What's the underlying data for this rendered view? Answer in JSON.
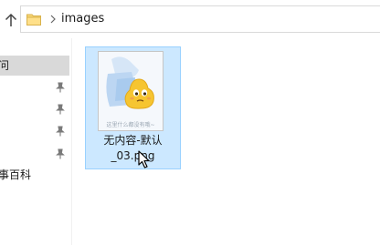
{
  "address_bar": {
    "path_segment": "images",
    "up_icon": "arrow-up-icon",
    "folder_icon": "folder-icon",
    "separator_icon": "chevron-right-icon"
  },
  "nav_pane": {
    "items": [
      {
        "label": "问",
        "selected": true,
        "pinned": false
      },
      {
        "label": "",
        "selected": false,
        "pinned": true
      },
      {
        "label": "",
        "selected": false,
        "pinned": true
      },
      {
        "label": "",
        "selected": false,
        "pinned": true
      },
      {
        "label": "",
        "selected": false,
        "pinned": true
      },
      {
        "label": "事百科",
        "selected": false,
        "pinned": false
      }
    ]
  },
  "content": {
    "files": [
      {
        "name_line1": "无内容-默认",
        "name_line2": "_03.png",
        "selected": true,
        "thumbnail_caption": "这里什么都没有哦~"
      }
    ]
  },
  "colors": {
    "selection_fill": "#cce8ff",
    "selection_border": "#99d1ff",
    "nav_selected": "#d9d9d9"
  }
}
